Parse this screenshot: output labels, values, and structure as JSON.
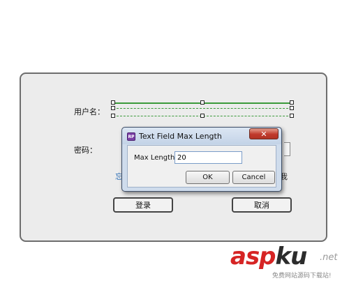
{
  "form": {
    "username_label": "用户名：",
    "password_label": "密码：",
    "blue_fragment": "忘",
    "right_fragment": "我",
    "login_button": "登录",
    "cancel_button": "取消"
  },
  "dialog": {
    "title": "Text Field Max Length",
    "app_icon_text": "RP",
    "close_glyph": "✕",
    "field_label": "Max Length",
    "field_value": "20",
    "ok_label": "OK",
    "cancel_label": "Cancel"
  },
  "watermark": {
    "brand_red": "asp",
    "brand_dark": "ku",
    "tld": ".net",
    "subtitle": "免费网站源码下载站!"
  },
  "colors": {
    "selection_green": "#3a9a3a",
    "link_blue": "#2d6fb7",
    "close_red": "#c0392b",
    "brand_red": "#d62424"
  },
  "icons": [
    "axure-rp-icon",
    "close-icon"
  ]
}
